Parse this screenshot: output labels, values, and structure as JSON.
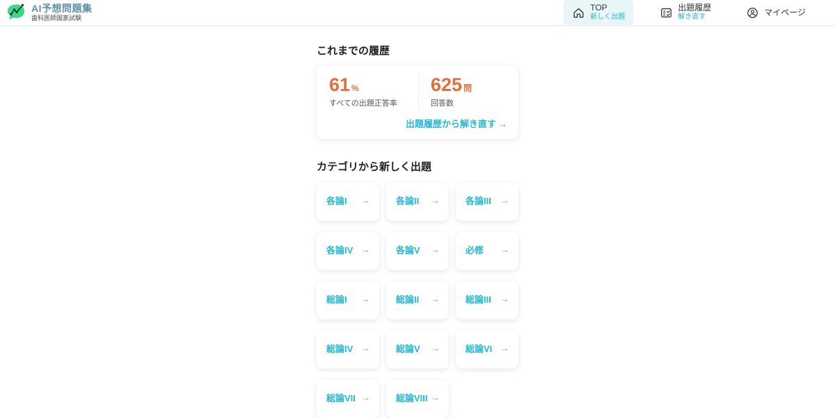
{
  "header": {
    "logo": {
      "icon": "chat-bubble-chart-logo",
      "title": "AI予想問題集",
      "subtitle": "歯科医師国家試験"
    },
    "nav": {
      "top": {
        "label": "TOP",
        "sublabel": "新しく出題"
      },
      "history": {
        "label": "出題履歴",
        "sublabel": "解き直す"
      },
      "mypage": {
        "label": "マイページ"
      }
    }
  },
  "history_section": {
    "heading": "これまでの履歴",
    "stats": [
      {
        "value": "61",
        "unit": "%",
        "label": "すべての出題正答率"
      },
      {
        "value": "625",
        "unit": "問",
        "label": "回答数"
      }
    ],
    "link": {
      "label": "出題履歴から解き直す",
      "arrow": "→"
    }
  },
  "category_section": {
    "heading": "カテゴリから新しく出題",
    "arrow": "→",
    "items": [
      {
        "label": "各論I"
      },
      {
        "label": "各論II"
      },
      {
        "label": "各論III"
      },
      {
        "label": "各論IV"
      },
      {
        "label": "各論V"
      },
      {
        "label": "必修"
      },
      {
        "label": "総論I"
      },
      {
        "label": "総論II"
      },
      {
        "label": "総論III"
      },
      {
        "label": "総論IV"
      },
      {
        "label": "総論V"
      },
      {
        "label": "総論VI"
      },
      {
        "label": "総論VII"
      },
      {
        "label": "総論VIII"
      }
    ]
  },
  "colors": {
    "accent_cyan": "#25b7d3",
    "accent_orange": "#e2703a",
    "logo_green": "#3bd981",
    "active_nav_bg": "#e8f6f8"
  }
}
